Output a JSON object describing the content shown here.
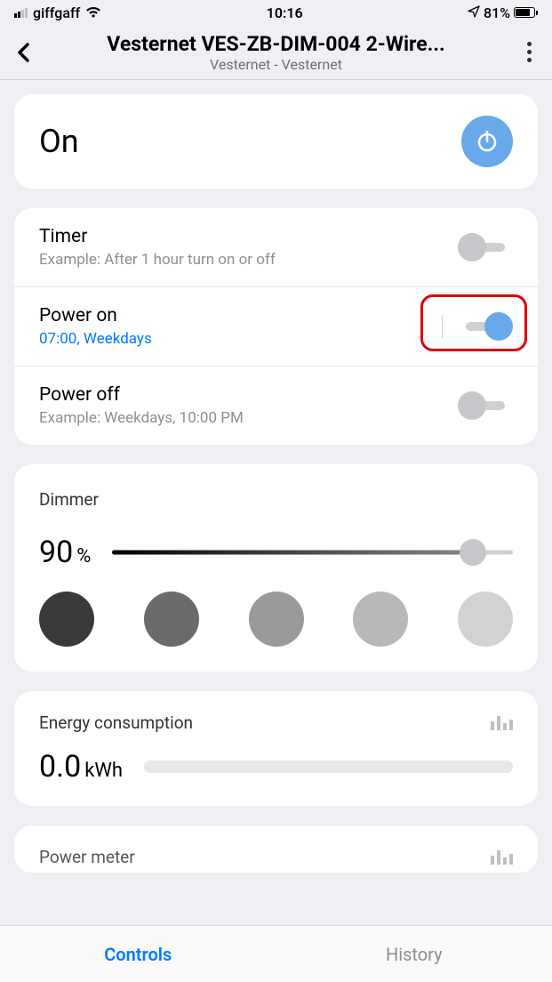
{
  "status_bar": {
    "carrier": "giffgaff",
    "time": "10:16",
    "battery_pct": "81%"
  },
  "header": {
    "title": "Vesternet VES-ZB-DIM-004 2-Wire...",
    "subtitle": "Vesternet - Vesternet"
  },
  "power": {
    "status": "On"
  },
  "timer": {
    "title": "Timer",
    "sub": "Example: After 1 hour turn on or off"
  },
  "power_on": {
    "title": "Power on",
    "sub": "07:00, Weekdays"
  },
  "power_off": {
    "title": "Power off",
    "sub": "Example: Weekdays, 10:00 PM"
  },
  "dimmer": {
    "label": "Dimmer",
    "value": "90",
    "unit": "%",
    "slider_pct": 90,
    "presets": [
      "#3a3a3a",
      "#6b6b6b",
      "#9a9a9a",
      "#b8b8b8",
      "#d2d2d2"
    ]
  },
  "energy": {
    "title": "Energy consumption",
    "value": "0.0",
    "unit": "kWh"
  },
  "power_meter": {
    "title": "Power meter"
  },
  "tabs": {
    "controls": "Controls",
    "history": "History"
  }
}
